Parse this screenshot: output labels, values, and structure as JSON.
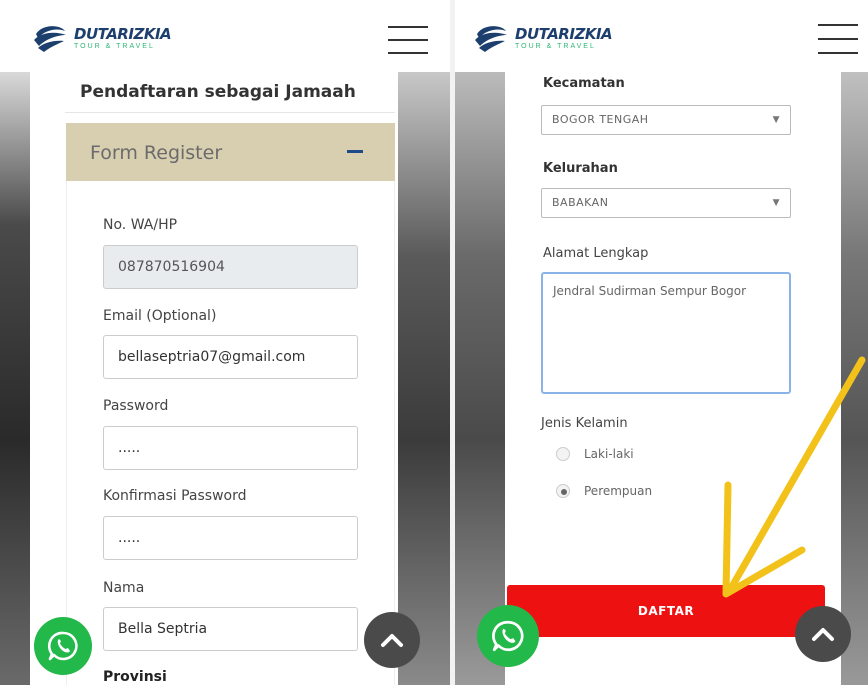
{
  "brand": {
    "name": "DUTARIZKIA",
    "tagline": "TOUR & TRAVEL",
    "primary_color": "#1d3f6e",
    "accent_color": "#2bb673"
  },
  "left_screen": {
    "page_title": "Pendaftaran sebagai Jamaah",
    "form_header": "Form Register",
    "collapse_icon": "minus-icon",
    "fields": {
      "phone": {
        "label": "No. WA/HP",
        "value": "087870516904"
      },
      "email": {
        "label": "Email (Optional)",
        "value": "bellaseptria07@gmail.com"
      },
      "password": {
        "label": "Password",
        "value": "....."
      },
      "password_confirm": {
        "label": "Konfirmasi Password",
        "value": "....."
      },
      "name": {
        "label": "Nama",
        "value": "Bella Septria"
      },
      "province": {
        "label": "Provinsi"
      }
    }
  },
  "right_screen": {
    "fields": {
      "kecamatan": {
        "label": "Kecamatan",
        "value": "BOGOR TENGAH"
      },
      "kelurahan": {
        "label": "Kelurahan",
        "value": "BABAKAN"
      },
      "alamat": {
        "label": "Alamat Lengkap",
        "value": "Jendral Sudirman Sempur Bogor"
      },
      "gender": {
        "label": "Jenis Kelamin",
        "options": [
          "Laki-laki",
          "Perempuan"
        ],
        "selected": "Perempuan"
      }
    },
    "submit_label": "DAFTAR",
    "submit_color": "#ee1111"
  },
  "floating": {
    "whatsapp_icon": "whatsapp-icon",
    "scroll_top_icon": "chevron-up-icon",
    "whatsapp_color": "#22b84a"
  },
  "annotation": {
    "arrow_color": "#f2c21b",
    "arrow_icon": "arrow-icon"
  }
}
